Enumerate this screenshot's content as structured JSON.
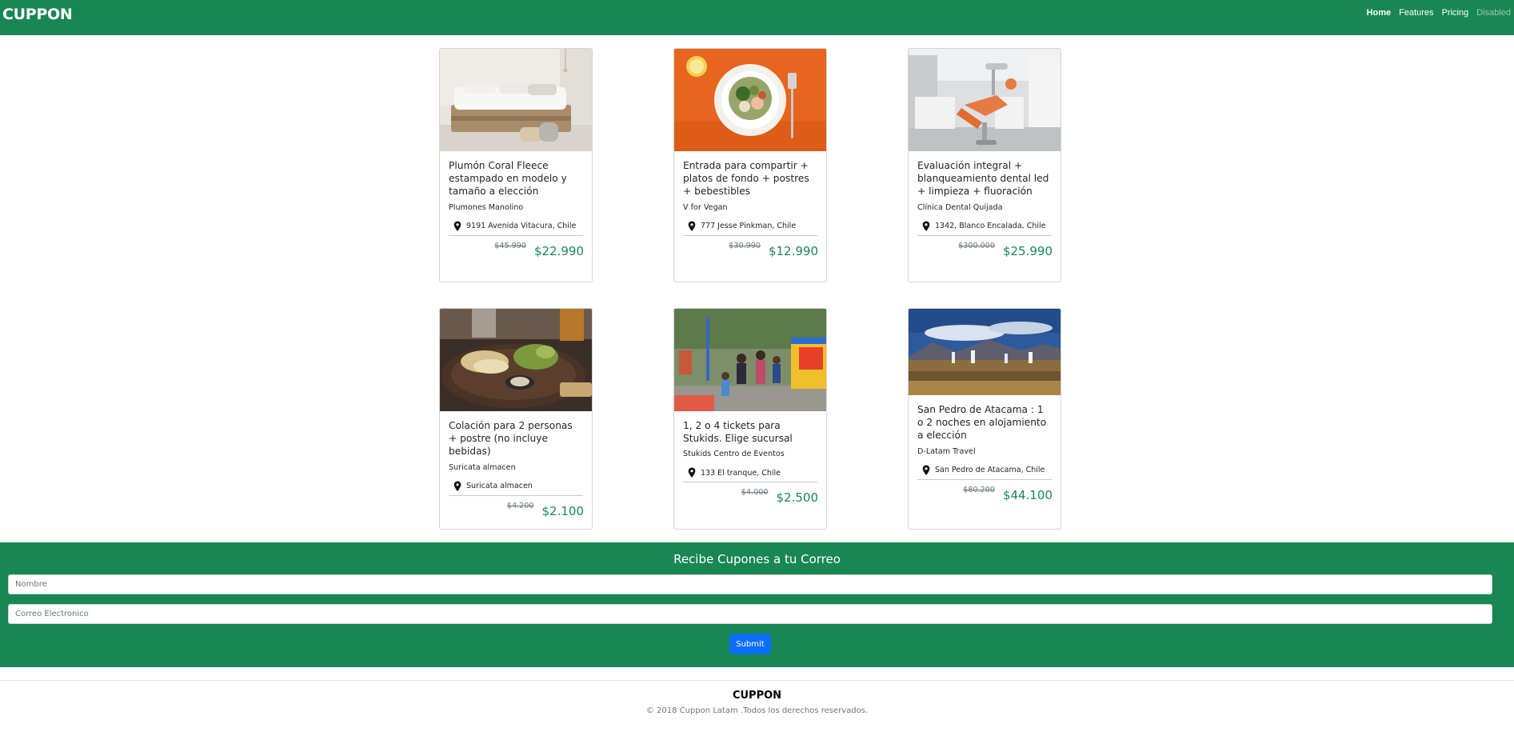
{
  "brand": "CUPPON",
  "nav": {
    "home": "Home",
    "features": "Features",
    "pricing": "Pricing",
    "disabled": "Disabled"
  },
  "colors": {
    "primary_green": "#198754",
    "submit_blue": "#0d6efd"
  },
  "icons": {
    "location": "map-pin-icon"
  },
  "cards": [
    {
      "title": "Plumón Coral Fleece estampado en modelo y tamaño a elección",
      "merchant": "Plumones Manolino",
      "location": "9191 Avenida Vitacura, Chile",
      "old_price": "$45.990",
      "new_price": "$22.990"
    },
    {
      "title": "Entrada para compartir + platos de fondo + postres + bebestibles",
      "merchant": "V for Vegan",
      "location": "777 Jesse Pinkman, Chile",
      "old_price": "$30.990",
      "new_price": "$12.990"
    },
    {
      "title": "Evaluación integral + blanqueamiento dental led + limpieza + fluoración",
      "merchant": "Clínica Dental Quijada",
      "location": "1342, Blanco Encalada, Chile",
      "old_price": "$300.000",
      "new_price": "$25.990"
    },
    {
      "title": "Colación para 2 personas + postre (no incluye bebidas)",
      "merchant": "Suricata almacen",
      "location": "Suricata almacen",
      "old_price": "$4.200",
      "new_price": "$2.100"
    },
    {
      "title": "1, 2 o 4 tickets para Stukids. Elige sucursal",
      "merchant": "Stukids Centro de Eventos",
      "location": "133 El tranque, Chile",
      "old_price": "$4.000",
      "new_price": "$2.500"
    },
    {
      "title": "San Pedro de Atacama : 1 o 2 noches en alojamiento a elección",
      "merchant": "D-Latam Travel",
      "location": "San Pedro de Atacama, Chile",
      "old_price": "$80.200",
      "new_price": "$44.100"
    }
  ],
  "newsletter": {
    "title": "Recibe Cupones a tu Correo",
    "name_placeholder": "Nombre",
    "email_placeholder": "Correo Electronico",
    "submit": "Submit"
  },
  "footer": {
    "brand": "CUPPON",
    "copyright": "© 2018 Cuppon Latam .Todos los derechos reservados."
  }
}
